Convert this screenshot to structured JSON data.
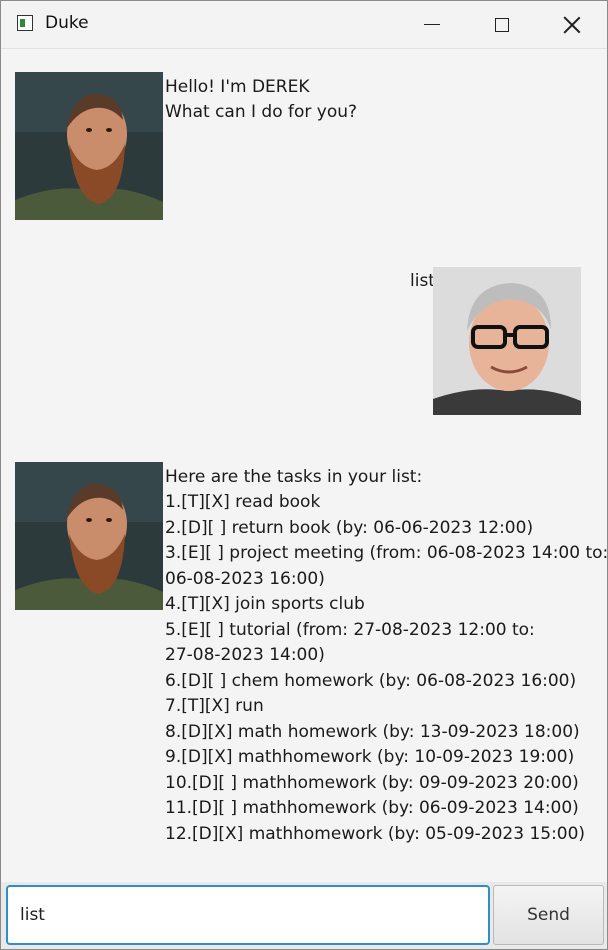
{
  "window": {
    "title": "Duke"
  },
  "conversation": {
    "bot_greeting": [
      "Hello! I'm DEREK",
      "What can I do for you?"
    ],
    "user_message": "list",
    "bot_list_reply": [
      "Here are the tasks in your list:",
      "1.[T][X] read book",
      "2.[D][ ] return book (by: 06-06-2023 12:00)",
      "3.[E][ ] project meeting (from: 06-08-2023 14:00 to:",
      "06-08-2023 16:00)",
      "4.[T][X] join sports club",
      "5.[E][ ] tutorial (from: 27-08-2023 12:00 to:",
      "27-08-2023 14:00)",
      "6.[D][ ] chem homework (by: 06-08-2023 16:00)",
      "7.[T][X] run",
      "8.[D][X] math homework (by: 13-09-2023 18:00)",
      "9.[D][X] mathhomework (by: 10-09-2023 19:00)",
      "10.[D][ ] mathhomework (by: 09-09-2023 20:00)",
      "11.[D][ ] mathhomework (by: 06-09-2023 14:00)",
      "12.[D][X] mathhomework (by: 05-09-2023 15:00)"
    ]
  },
  "input": {
    "value": "list",
    "send_label": "Send"
  },
  "colors": {
    "input_focus_border": "#2f8fc4",
    "background": "#f4f4f4"
  },
  "icons": {
    "bot_avatar": "bearded-man-avatar",
    "user_avatar": "man-with-glasses-avatar"
  }
}
